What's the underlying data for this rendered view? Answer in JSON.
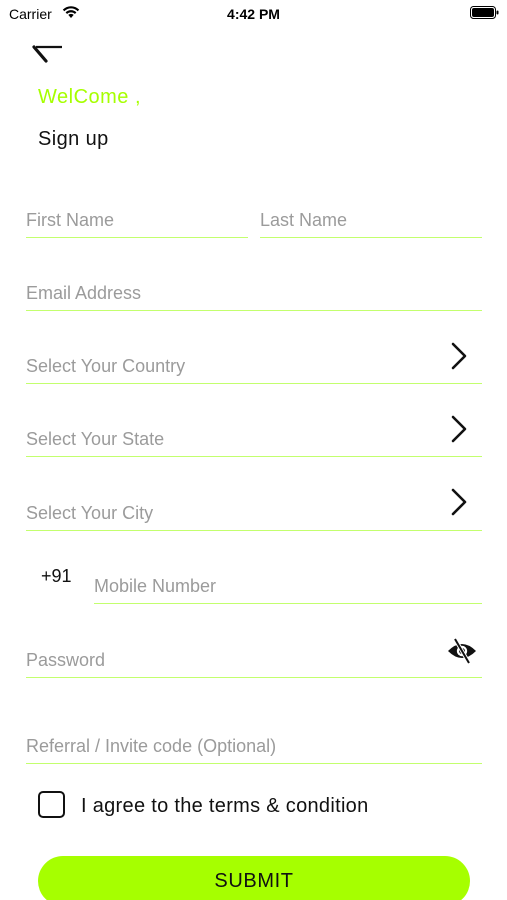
{
  "status_bar": {
    "carrier": "Carrier",
    "time": "4:42 PM"
  },
  "header": {
    "welcome": "WelCome ,",
    "title": "Sign up"
  },
  "form": {
    "first_name_placeholder": "First Name",
    "last_name_placeholder": "Last Name",
    "email_placeholder": "Email Address",
    "country_placeholder": "Select Your Country",
    "state_placeholder": "Select Your State",
    "city_placeholder": "Select Your City",
    "country_code": "+91",
    "mobile_placeholder": "Mobile Number",
    "password_placeholder": "Password",
    "referral_placeholder": "Referral / Invite code (Optional)"
  },
  "terms": {
    "label": "I agree to the terms & condition",
    "checked": false
  },
  "submit_label": "SUBMIT",
  "icons": {
    "back": "back-arrow-icon",
    "chevron": "chevron-right-icon",
    "eye": "eye-slash-icon",
    "wifi": "wifi-icon",
    "battery": "battery-icon"
  },
  "colors": {
    "accent": "#a6ff00",
    "underline": "#c3ff6e",
    "placeholder": "#9b9b9b",
    "text": "#111111"
  }
}
